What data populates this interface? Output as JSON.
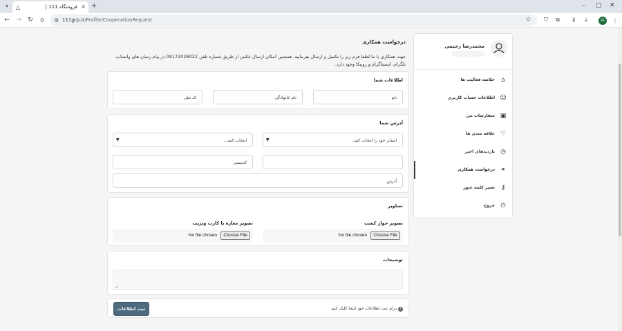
{
  "browser": {
    "tab_title": "فروشگاه 111 |",
    "tab_favicon": "triangle-logo-icon",
    "new_tab_icon": "plus-icon",
    "url_host": "111grp.ir",
    "url_path": "/Profile/CooperationRequest",
    "profile_initial": "ᗣ"
  },
  "sidebar": {
    "user_name": "محمدرضا رحیمی",
    "items": [
      {
        "label": "خلاصه فعالیت ها",
        "icon": "home-icon"
      },
      {
        "label": "اطلاعات حساب کاربری",
        "icon": "user-icon"
      },
      {
        "label": "سفارشات من",
        "icon": "orders-icon"
      },
      {
        "label": "علاقه مندی ها",
        "icon": "heart-icon"
      },
      {
        "label": "بازدیدهای اخیر",
        "icon": "clock-icon"
      },
      {
        "label": "درخواست همکاری",
        "icon": "handshake-icon"
      },
      {
        "label": "تغییر کلمه عبور",
        "icon": "key-icon"
      },
      {
        "label": "خروج",
        "icon": "power-icon"
      }
    ]
  },
  "main": {
    "title": "درخواست همکاری",
    "intro": "جهت همکاری با ما لطفا فرم زیر را تکمیل و ارسال بفرمایید. همچنین امکان ارسال عکس از طریق شماره تلفن 09172028022 در پیام رسان های واتساپ، تلگرام، اینستاگرام و روبیکا وجود دارد.",
    "personal": {
      "title": "اطلاعات شما",
      "first_name": "نام",
      "last_name": "نام خانوادگی",
      "national_code": "کد ملی"
    },
    "address": {
      "title": "آدرس شما",
      "province_select": "استان خود را انتخاب کنید.",
      "city_select": "انتخاب کنید...",
      "postal_code": "کدپستی",
      "address": "آدرس"
    },
    "images": {
      "title": "تصاویر",
      "license_label": "تصویر جواز کسب",
      "shop_label": "تصویر مغازه یا کارت ویزیت",
      "choose_file": "Choose File",
      "no_file": "No file chosen"
    },
    "description": {
      "title": "توضیحات"
    },
    "submit": {
      "button": "ثبت اطلاعات",
      "hint": "برای ثبت اطلاعات خود اینجا کلیک کنید"
    }
  },
  "colors": {
    "submit_button": "#4d6a7e",
    "avatar_green": "#1f6b3a"
  }
}
